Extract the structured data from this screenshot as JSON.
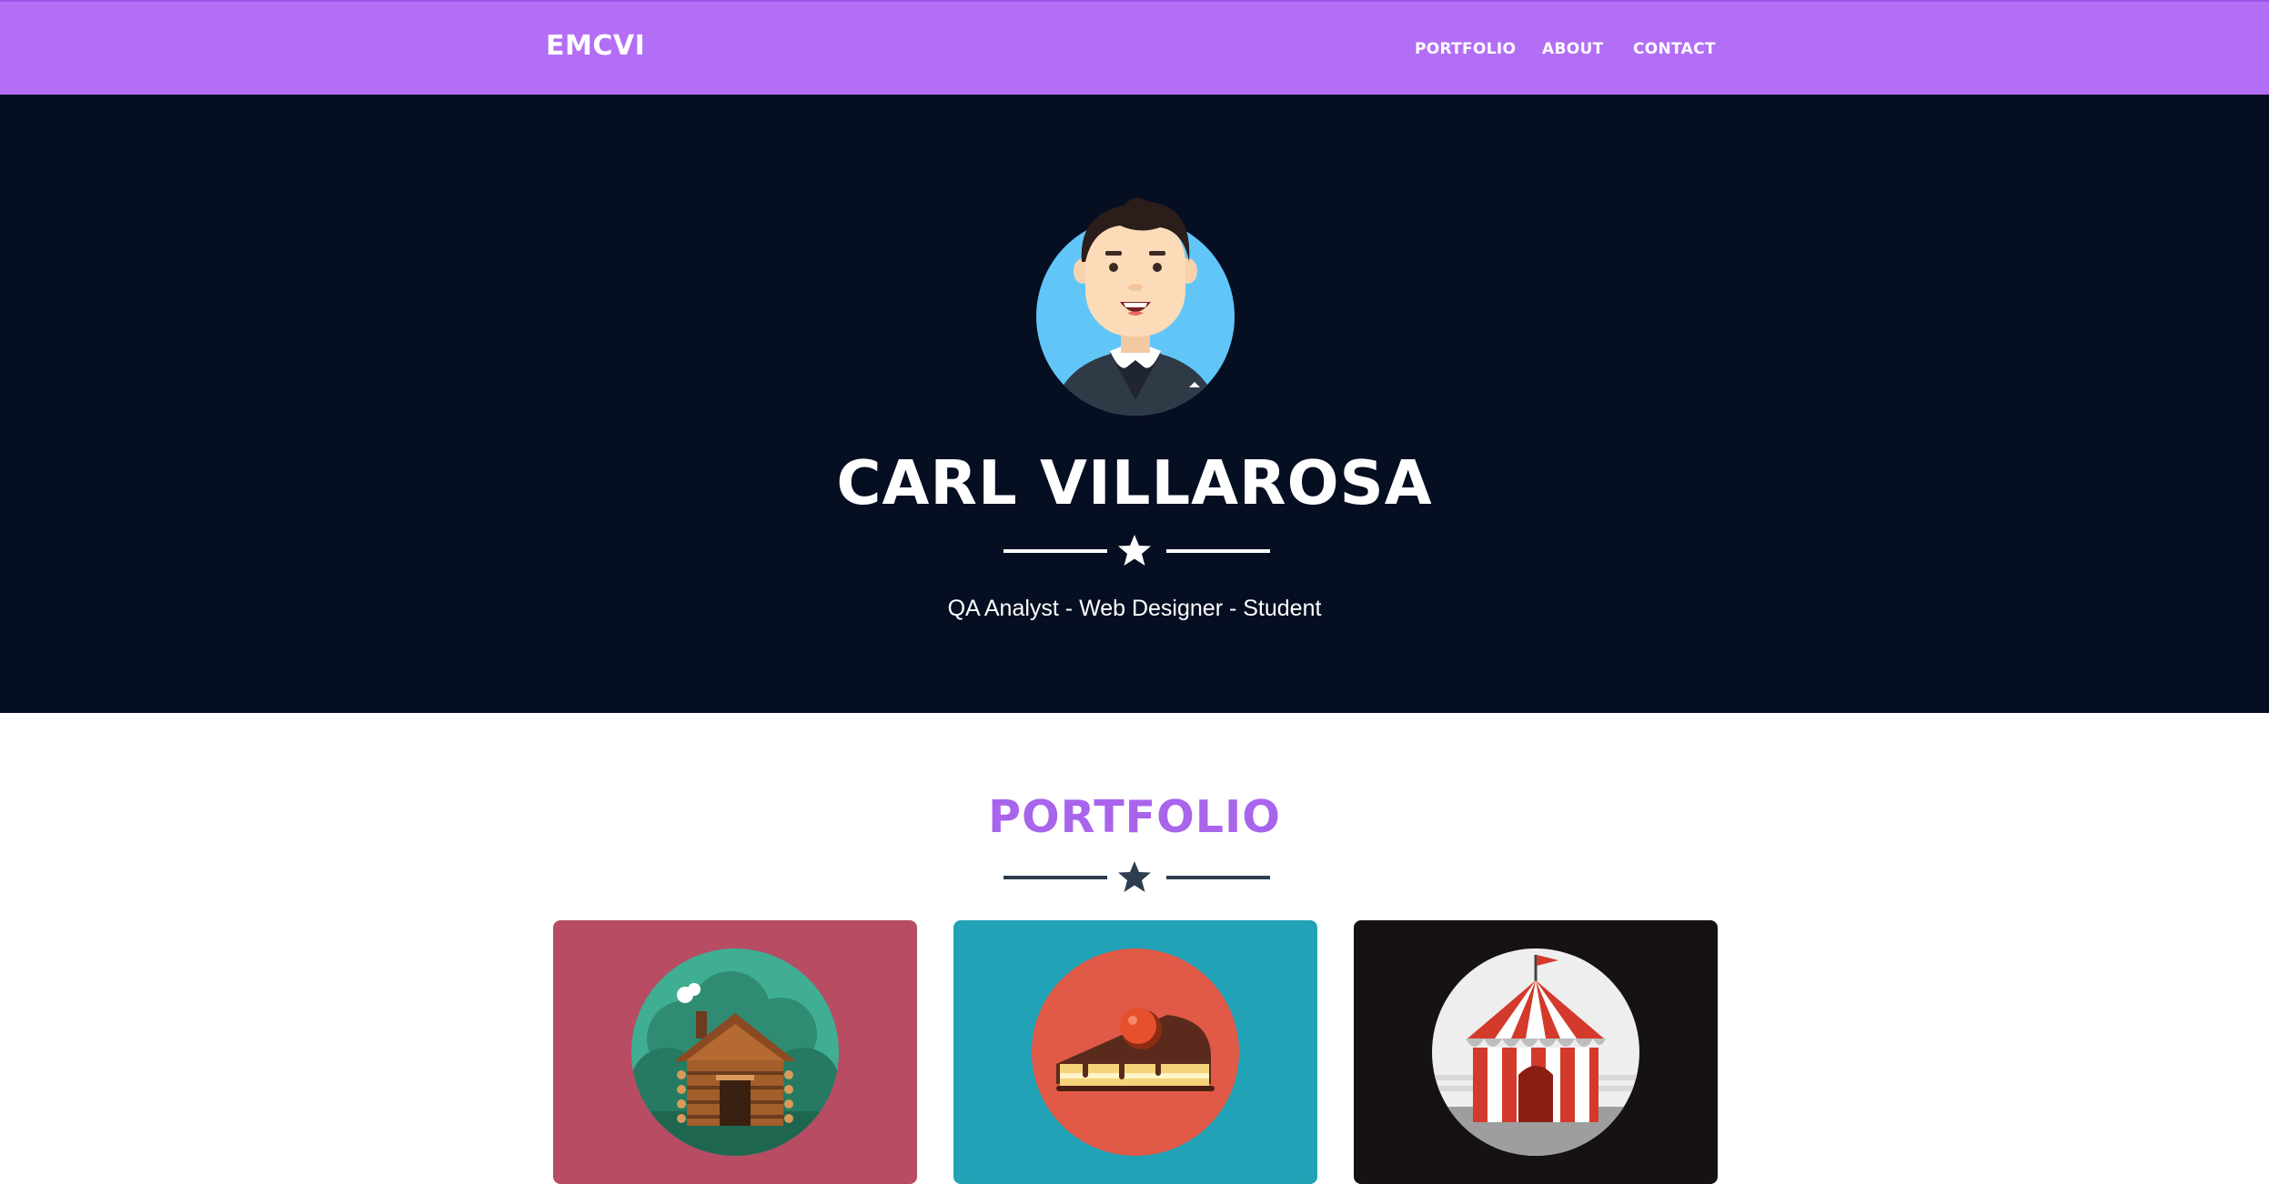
{
  "navbar": {
    "brand": "EMCVI",
    "links": [
      "PORTFOLIO",
      "ABOUT",
      "CONTACT"
    ],
    "background": "#b36ef6"
  },
  "hero": {
    "name": "CARL VILLAROSA",
    "subtitle": "QA Analyst - Web Designer - Student",
    "divider_icon": "star-icon",
    "background": "#060e22"
  },
  "portfolio": {
    "title": "PORTFOLIO",
    "divider_icon": "star-icon",
    "items": [
      {
        "icon": "cabin-icon",
        "background": "#b74c62"
      },
      {
        "icon": "cake-icon",
        "background": "#21a2b6"
      },
      {
        "icon": "circus-tent-icon",
        "background": "#161213"
      }
    ]
  },
  "colors": {
    "accent": "#a964ec",
    "dark": "#2c3e50"
  }
}
